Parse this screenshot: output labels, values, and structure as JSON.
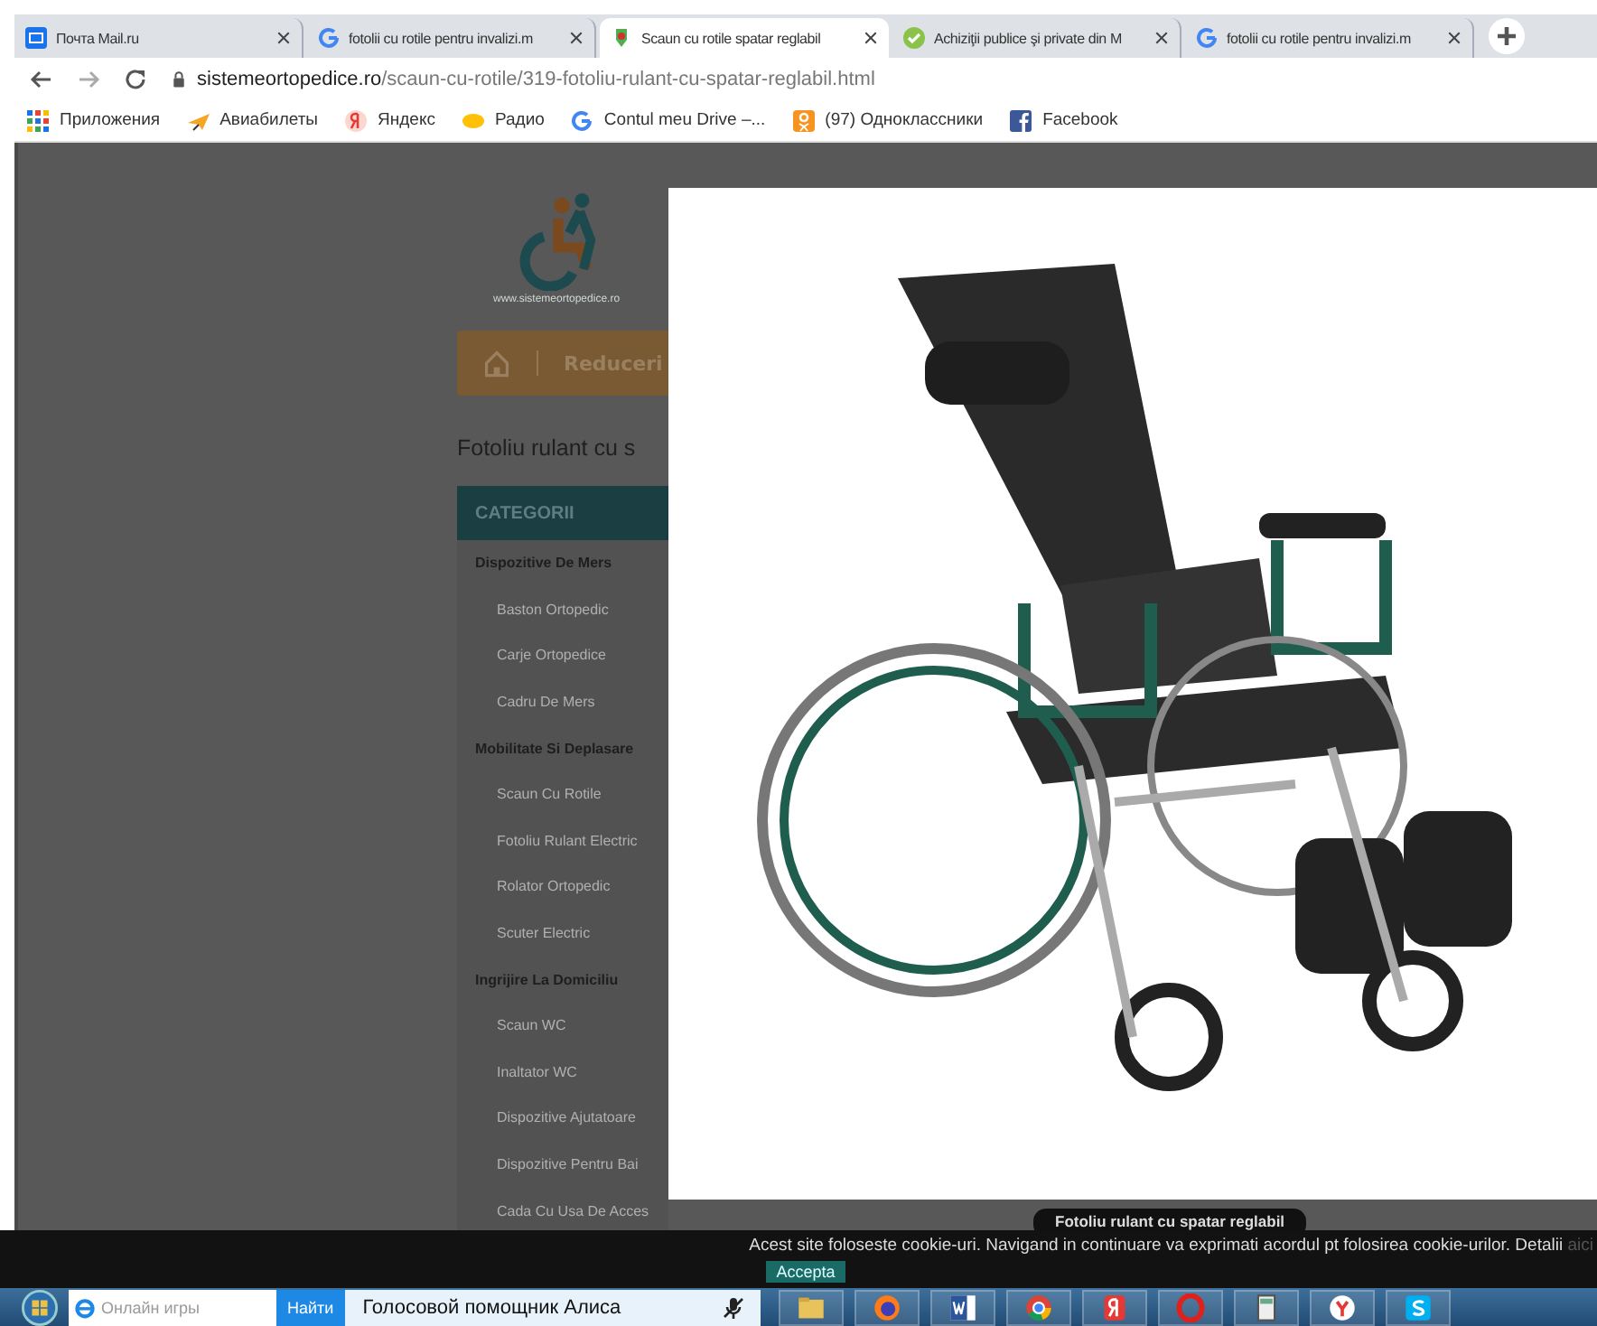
{
  "browser": {
    "tabs": [
      {
        "title": "Почта Mail.ru",
        "selected": false
      },
      {
        "title": "fotolii cu rotile pentru invalizi.m",
        "selected": false
      },
      {
        "title": "Scaun cu rotile spatar reglabil",
        "selected": true
      },
      {
        "title": "Achiziţii publice şi private din M",
        "selected": false
      },
      {
        "title": "fotolii cu rotile pentru invalizi.m",
        "selected": false
      }
    ],
    "address": {
      "domain": "sistemeortopedice.ro",
      "path": "/scaun-cu-rotile/319-fotoliu-rulant-cu-spatar-reglabil.html"
    },
    "bookmarks": [
      {
        "label": "Приложения"
      },
      {
        "label": "Авиабилеты"
      },
      {
        "label": "Яндекс"
      },
      {
        "label": "Радио"
      },
      {
        "label": "Contul meu Drive –..."
      },
      {
        "label": "(97) Одноклассники"
      },
      {
        "label": "Facebook"
      }
    ]
  },
  "site": {
    "logo_text": "www.sistemeortopedice.ro",
    "nav": [
      "Reduceri"
    ],
    "heading": "Fotoliu rulant cu s",
    "sidebar": {
      "title": "CATEGORII",
      "categories": [
        {
          "label": "Dispozitive De Mers",
          "children": [
            {
              "label": "Baston Ortopedic"
            },
            {
              "label": "Carje Ortopedice"
            },
            {
              "label": "Cadru De Mers"
            }
          ]
        },
        {
          "label": "Mobilitate Si Deplasare",
          "children": [
            {
              "label": "Scaun Cu Rotile"
            },
            {
              "label": "Fotoliu Rulant Electric"
            },
            {
              "label": "Rolator Ortopedic"
            },
            {
              "label": "Scuter Electric"
            }
          ]
        },
        {
          "label": "Ingrijire La Domiciliu",
          "children": [
            {
              "label": "Scaun WC"
            },
            {
              "label": "Inaltator WC"
            },
            {
              "label": "Dispozitive Ajutatoare"
            },
            {
              "label": "Dispozitive Pentru Bai"
            },
            {
              "label": "Cada Cu Usa De Acces"
            }
          ]
        }
      ]
    }
  },
  "lightbox": {
    "caption": "Fotoliu rulant cu spatar reglabil"
  },
  "cookie_bar": {
    "text": "Acest site foloseste cookie-uri. Navigand in continuare va exprimati acordul pt folosirea cookie-urilor. Detalii",
    "link": "aici",
    "button": "Accepta"
  },
  "taskbar": {
    "search_placeholder": "Онлайн игры",
    "search_button": "Найти",
    "assistant": "Голосовой помощник Алиса"
  }
}
